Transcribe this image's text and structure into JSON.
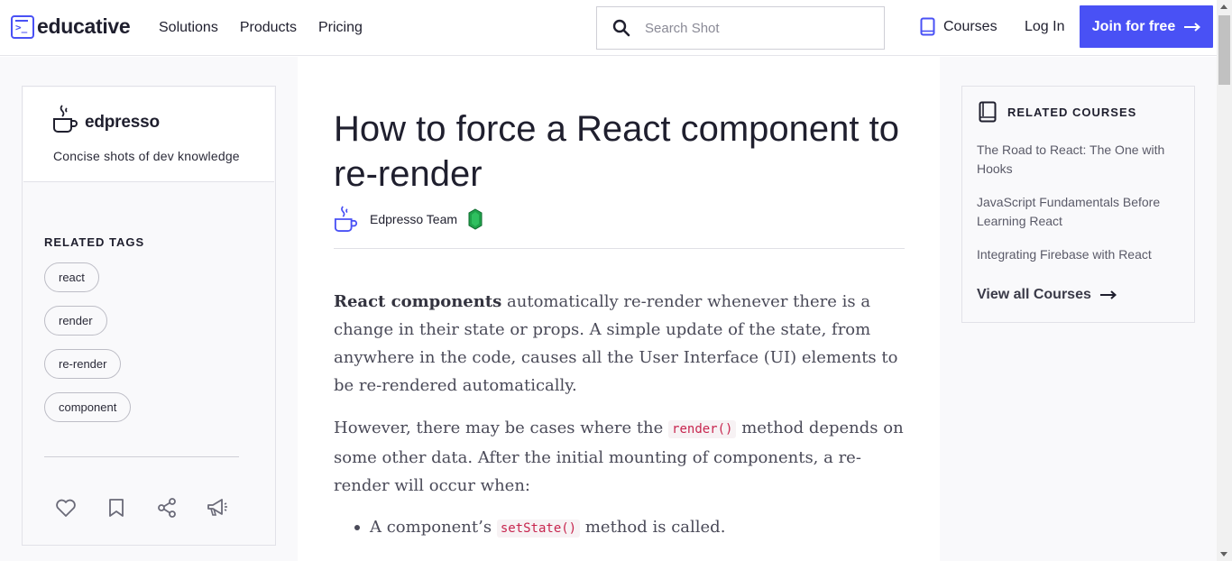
{
  "header": {
    "logo_text": "educative",
    "nav": [
      "Solutions",
      "Products",
      "Pricing"
    ],
    "search_placeholder": "Search Shot",
    "courses_label": "Courses",
    "login_label": "Log In",
    "join_label": "Join for free",
    "accent_color": "#4951f5"
  },
  "sidebar": {
    "brand_name": "edpresso",
    "tagline": "Concise shots of dev knowledge",
    "tags_heading": "RELATED TAGS",
    "tags": [
      "react",
      "render",
      "re-render",
      "component"
    ],
    "actions": [
      "heart-icon",
      "bookmark-icon",
      "share-icon",
      "megaphone-icon"
    ]
  },
  "article": {
    "title": "How to force a React component to re-render",
    "author": "Edpresso Team",
    "p1_bold": "React components",
    "p1_rest": " automatically re-render whenever there is a change in their state or props. A simple update of the state, from anywhere in the code, causes all the User Interface (UI) elements to be re-rendered automatically.",
    "p2_before": "However, there may be cases where the ",
    "p2_code": "render()",
    "p2_after": " method depends on some other data. After the initial mounting of components, a re-render will occur when:",
    "bullet_before": "A component’s ",
    "bullet_code": "setState()",
    "bullet_after": " method is called."
  },
  "related_courses": {
    "heading": "RELATED COURSES",
    "items": [
      "The Road to React: The One with Hooks",
      "JavaScript Fundamentals Before Learning React",
      "Integrating Firebase with React"
    ],
    "view_all": "View all Courses"
  }
}
